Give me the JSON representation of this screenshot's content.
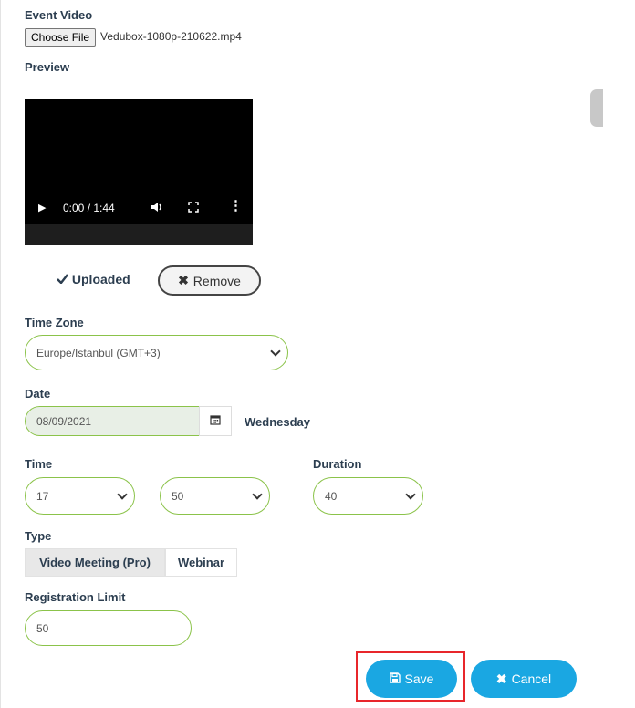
{
  "video_section": {
    "label": "Event Video",
    "choose_file_label": "Choose File",
    "file_name": "Vedubox-1080p-210622.mp4",
    "preview_label": "Preview",
    "player": {
      "time_display": "0:00 / 1:44",
      "progress": 0.03,
      "play_glyph": "▶",
      "volume_glyph": "🔊",
      "fullscreen_glyph": "⛶",
      "more_glyph": "⋮"
    },
    "uploaded_label": "Uploaded",
    "remove_label": "Remove"
  },
  "timezone": {
    "label": "Time Zone",
    "value": "Europe/Istanbul (GMT+3)"
  },
  "date": {
    "label": "Date",
    "value": "08/09/2021",
    "weekday": "Wednesday"
  },
  "time": {
    "label": "Time",
    "hour": "17",
    "minute": "50"
  },
  "duration": {
    "label": "Duration",
    "value": "40"
  },
  "type": {
    "label": "Type",
    "options": [
      "Video Meeting (Pro)",
      "Webinar"
    ],
    "selected": "Video Meeting (Pro)"
  },
  "registration": {
    "label": "Registration Limit",
    "value": "50"
  },
  "actions": {
    "save_label": "Save",
    "cancel_label": "Cancel"
  },
  "colors": {
    "accent": "#8bc34a",
    "primary_button": "#1aa7e2",
    "highlight": "#e8262b",
    "heading": "#2c3e50"
  },
  "icons": {
    "check": "check-icon",
    "remove": "x-icon",
    "calendar": "calendar-icon",
    "save": "floppy-disk-icon",
    "cancel": "x-icon",
    "dropdown": "chevron-down-icon"
  }
}
